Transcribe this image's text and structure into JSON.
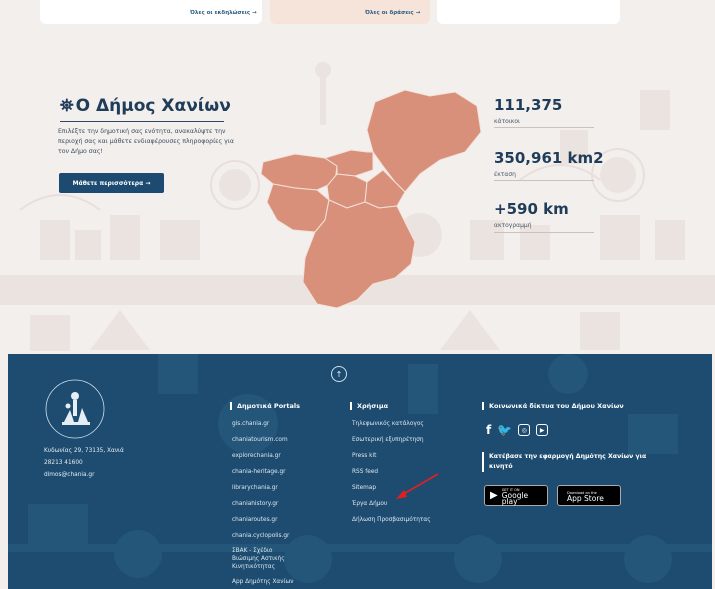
{
  "top_links": {
    "events": "Όλες οι εκδηλώσεις →",
    "actions": "Όλες οι δράσεις →"
  },
  "hero": {
    "title": "Ο Δήμος Χανίων",
    "description": "Επιλέξτε την δημοτική σας ενότητα, ανακαλύψτε την περιοχή σας και μάθετε ενδιαφέρουσες πληροφορίες για τον Δήμο σας!",
    "button": "Μάθετε περισσότερα →"
  },
  "stats": [
    {
      "value": "111,375",
      "label": "κάτοικοι"
    },
    {
      "value": "350,961 km2",
      "label": "έκταση"
    },
    {
      "value": "+590 km",
      "label": "ακτογραμμή"
    }
  ],
  "footer": {
    "address_lines": [
      "Κυδωνίας 29, 73135, Χανιά",
      "28213 41600",
      "dimos@chania.gr"
    ],
    "portals": {
      "heading": "Δημοτικά Portals",
      "items": [
        "gis.chania.gr",
        "chaniatourism.com",
        "explorechania.gr",
        "chania-heritage.gr",
        "librarychania.gr",
        "chaniahistory.gr",
        "chaniaroutes.gr",
        "chania.cyclopolis.gr",
        "ΣΒΑΚ - Σχέδιο",
        "Βιώσιμης Αστικής",
        "Κινητικότητας",
        "App Δημότης Χανίων"
      ]
    },
    "useful": {
      "heading": "Χρήσιμα",
      "items": [
        "Τηλεφωνικός κατάλογος",
        "Εσωτερική εξυπηρέτηση",
        "Press kit",
        "RSS feed",
        "Sitemap",
        "Έργα Δήμου",
        "Δήλωση Προσβασιμότητας"
      ]
    },
    "social": {
      "heading": "Κοινωνικά δίκτυα του Δήμου Χανίων",
      "icons": [
        "facebook-icon",
        "twitter-icon",
        "instagram-icon",
        "youtube-icon"
      ]
    },
    "app": {
      "heading": "Κατέβασε την εφαρμογή Δημότης Χανίων για κινητό",
      "google_small": "GET IT ON",
      "google_big": "Google play",
      "apple_small": "Download on the",
      "apple_big": "App Store"
    }
  },
  "colors": {
    "map_fill": "#d9907a",
    "footer_bg": "#1d4c70",
    "button_bg": "#1c4a70",
    "arrow": "#e02020"
  }
}
